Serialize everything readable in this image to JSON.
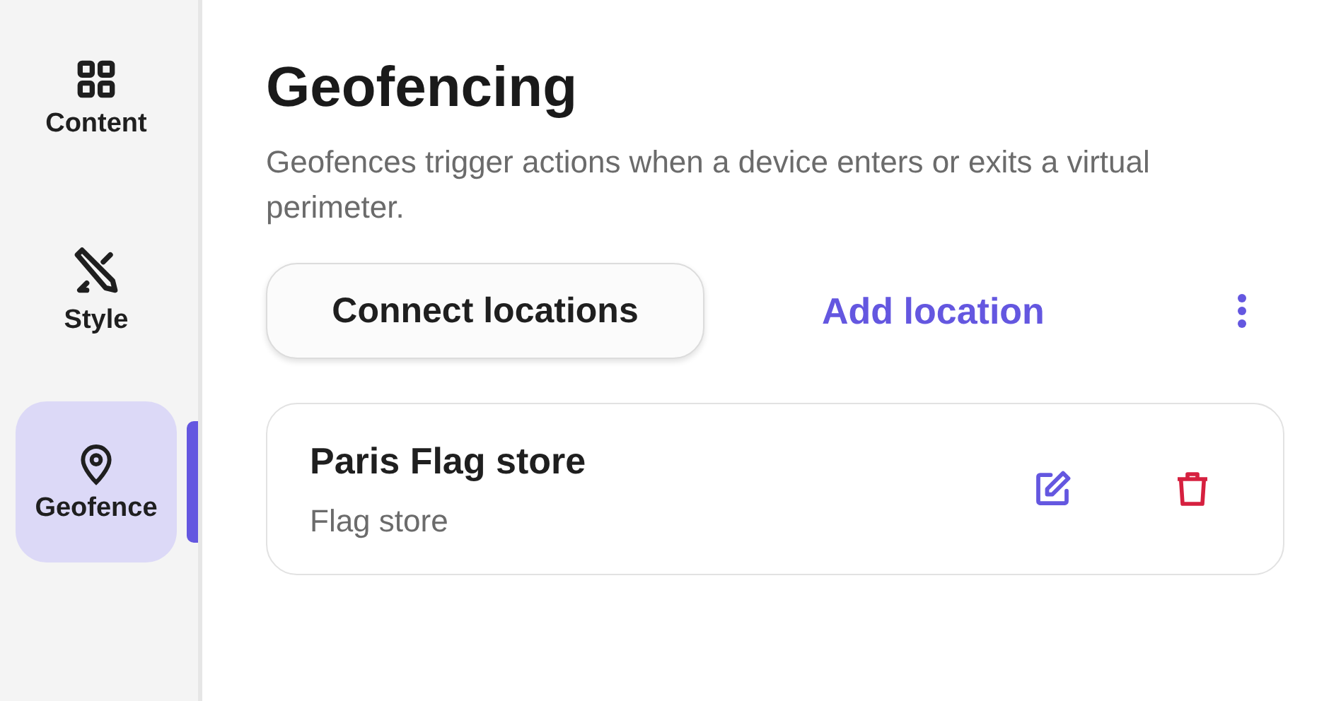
{
  "sidebar": {
    "items": [
      {
        "label": "Content",
        "selected": false
      },
      {
        "label": "Style",
        "selected": false
      },
      {
        "label": "Geofence",
        "selected": true
      }
    ]
  },
  "title": "Geofencing",
  "description": "Geofences trigger actions when a device enters or exits a virtual perimeter.",
  "actions": {
    "primary": "Connect locations",
    "link": "Add location"
  },
  "locations": [
    {
      "name": "Paris Flag store",
      "category": "Flag store"
    }
  ]
}
